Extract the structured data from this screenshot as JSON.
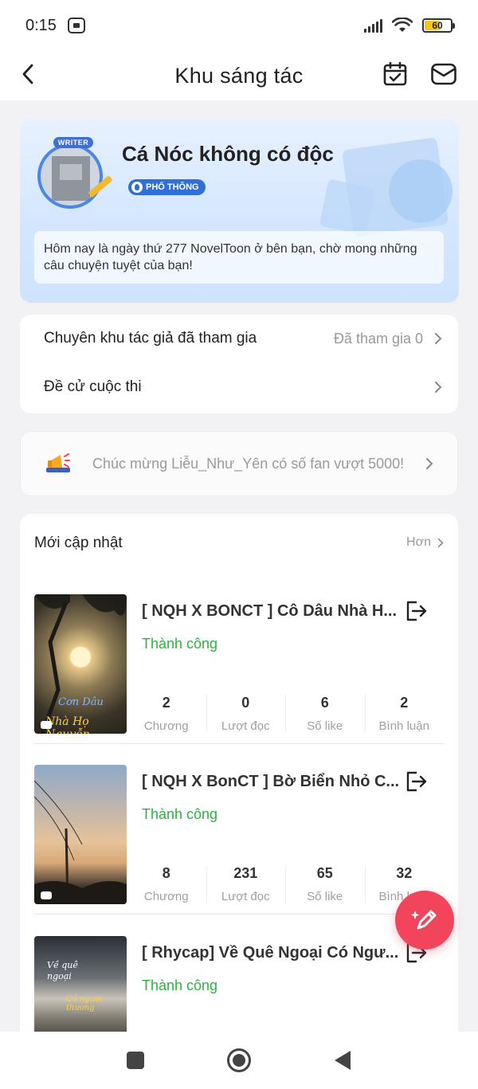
{
  "status_bar": {
    "time": "0:15",
    "battery_level": "60",
    "battery_fraction": 0.6,
    "icons": [
      "app-notification-icon",
      "signal-icon",
      "wifi-icon",
      "battery-icon"
    ]
  },
  "app_bar": {
    "title": "Khu sáng tác",
    "back_icon": "chevron-left-icon",
    "calendar_icon": "calendar-check-icon",
    "mail_icon": "mail-icon"
  },
  "profile": {
    "avatar_badge": "WRITER",
    "name": "Cá Nóc không có độc",
    "level": "PHỔ THÔNG",
    "welcome": "Hôm nay là ngày thứ 277 NovelToon ở bên bạn, chờ mong những câu chuyện tuyệt của bạn!"
  },
  "menu": {
    "items": [
      {
        "label": "Chuyên khu tác giả đã tham gia",
        "meta": "Đã tham gia 0"
      },
      {
        "label": "Đề cử cuộc thi",
        "meta": ""
      }
    ]
  },
  "notice": {
    "text": "Chúc mừng Liễu_Như_Yên có số fan vượt 5000!",
    "icon": "megaphone-icon"
  },
  "updates": {
    "heading": "Mới cập nhật",
    "more_label": "Hơn",
    "stat_labels": [
      "Chương",
      "Lượt đọc",
      "Số like",
      "Bình luận"
    ],
    "books": [
      {
        "title": "[ NQH X BONCT ] Cô Dâu Nhà H...",
        "status": "Thành công",
        "cover_text_1": "Cơn Dâu",
        "cover_text_2": "Nhà Họ Nguyễn",
        "stats": [
          "2",
          "0",
          "6",
          "2"
        ]
      },
      {
        "title": "[ NQH X BonCT ] Bờ Biển Nhỏ C...",
        "status": "Thành công",
        "cover_text_1": "",
        "cover_text_2": "",
        "stats": [
          "8",
          "231",
          "65",
          "32"
        ]
      },
      {
        "title": "[ Rhycap] Về Quê Ngoại Có Ngư...",
        "status": "Thành công",
        "cover_text_1": "Về quê ngoại",
        "cover_text_2": "Có người thương",
        "stats": []
      }
    ]
  },
  "fab": {
    "icon": "pencil-sparkle-icon"
  },
  "nav_bar": {
    "icons": [
      "recents-square-icon",
      "home-circle-icon",
      "back-triangle-icon"
    ]
  },
  "colors": {
    "accent_blue": "#2f6fd6",
    "success_green": "#2fb240",
    "fab_red": "#f2455b",
    "battery_yellow": "#f5c518"
  }
}
